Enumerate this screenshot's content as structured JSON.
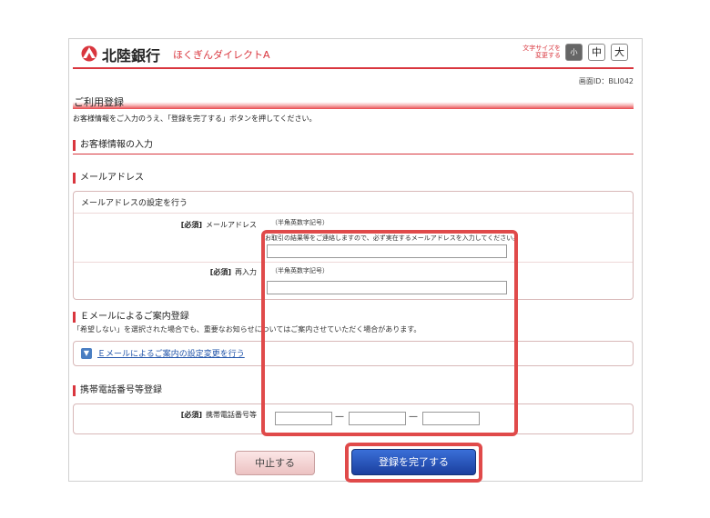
{
  "header": {
    "bank_name": "北陸銀行",
    "service_name": "ほくぎんダイレクトA",
    "fontsize_label_1": "文字サイズを",
    "fontsize_label_2": "変更する",
    "fontsize_small": "小",
    "fontsize_medium": "中",
    "fontsize_large": "大"
  },
  "screen_id": "画面ID：BLI042",
  "page": {
    "title": "ご利用登録",
    "instruction": "お客様情報をご入力のうえ、「登録を完了する」ボタンを押してください。"
  },
  "customer_section": {
    "title": "お客様情報の入力"
  },
  "email_section": {
    "title": "メールアドレス",
    "box_title": "メールアドレスの設定を行う",
    "required_tag": "[必須]",
    "email_label": "メールアドレス",
    "email_format": "（半角英数字記号）",
    "email_note": "お取引の結果等をご連絡しますので、必ず実在するメールアドレスを入力してください。",
    "email_value": "",
    "reenter_label": "再入力",
    "reenter_format": "（半角英数字記号）",
    "reenter_value": ""
  },
  "notify_section": {
    "title": "Ｅメールによるご案内登録",
    "note": "「希望しない」を選択された場合でも、重要なお知らせについてはご案内させていただく場合があります。",
    "link": "Ｅメールによるご案内の設定変更を行う"
  },
  "phone_section": {
    "title": "携帯電話番号等登録",
    "required_tag": "[必須]",
    "label": "携帯電話番号等",
    "part1": "",
    "part2": "",
    "part3": "",
    "separator": "—"
  },
  "buttons": {
    "cancel": "中止する",
    "submit": "登録を完了する"
  },
  "colors": {
    "accent": "#d9363e",
    "highlight": "#e04a4a",
    "submit": "#1b3f9e"
  }
}
